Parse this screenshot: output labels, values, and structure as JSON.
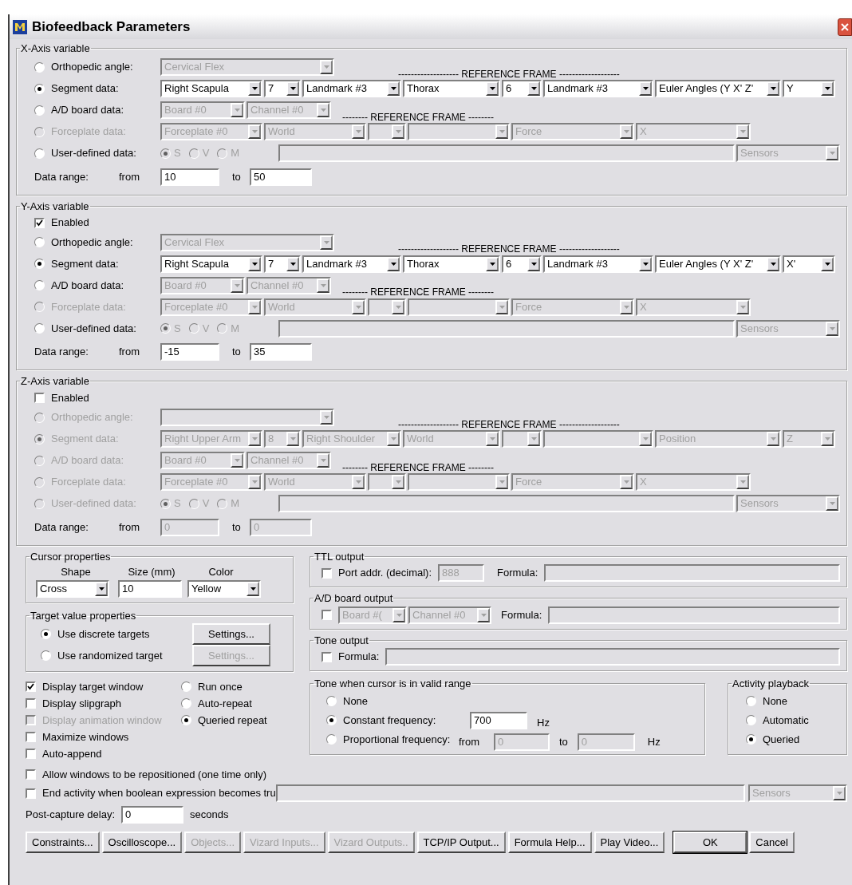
{
  "window": {
    "title": "Biofeedback Parameters"
  },
  "axes": [
    {
      "title": "X-Axis variable",
      "rows": [
        {
          "kind": "orthopedic",
          "label": "Orthopedic angle:",
          "selected": false,
          "disabled": false,
          "heading": "------------------- REFERENCE FRAME -------------------",
          "combos": [
            {
              "value": "Cervical Flex",
              "disabled": true
            }
          ]
        },
        {
          "kind": "segment",
          "label": "Segment data:",
          "selected": true,
          "disabled": false,
          "combos": [
            {
              "value": "Right Scapula",
              "disabled": false
            },
            {
              "value": "7",
              "disabled": false
            },
            {
              "value": "Landmark #3",
              "disabled": false
            },
            {
              "value": "Thorax",
              "disabled": false
            },
            {
              "value": "6",
              "disabled": false
            },
            {
              "value": "Landmark #3",
              "disabled": false
            },
            {
              "value": "Euler Angles (Y X' Z'",
              "disabled": false
            },
            {
              "value": "Y",
              "disabled": false
            }
          ]
        },
        {
          "kind": "ad",
          "label": "A/D board data:",
          "selected": false,
          "disabled": false,
          "heading": "-------- REFERENCE FRAME --------",
          "combos": [
            {
              "value": "Board #0",
              "disabled": true
            },
            {
              "value": "Channel #0",
              "disabled": true
            }
          ]
        },
        {
          "kind": "forceplate",
          "label": "Forceplate data:",
          "selected": false,
          "disabled": true,
          "combos": [
            {
              "value": "Forceplate #0",
              "disabled": true
            },
            {
              "value": "World",
              "disabled": true
            },
            {
              "disabled": true
            },
            {
              "disabled": true
            },
            {
              "value": "Force",
              "disabled": true
            },
            {
              "value": "X",
              "disabled": true
            }
          ]
        },
        {
          "kind": "user",
          "label": "User-defined data:",
          "selected": false,
          "disabled": false,
          "options": [
            {
              "label": "S",
              "selected": true
            },
            {
              "label": "V",
              "selected": false
            },
            {
              "label": "M",
              "selected": false
            }
          ],
          "combos": [
            {
              "value": "Sensors",
              "disabled": true
            }
          ]
        }
      ],
      "range": {
        "label": "Data range:",
        "from_label": "from",
        "from": "10",
        "to_label": "to",
        "to": "50",
        "disabled": false
      }
    },
    {
      "title": "Y-Axis variable",
      "enabled": {
        "label": "Enabled",
        "checked": true
      },
      "rows": [
        {
          "kind": "orthopedic",
          "label": "Orthopedic angle:",
          "selected": false,
          "disabled": false,
          "heading": "------------------- REFERENCE FRAME -------------------",
          "combos": [
            {
              "value": "Cervical Flex",
              "disabled": true
            }
          ]
        },
        {
          "kind": "segment",
          "label": "Segment data:",
          "selected": true,
          "disabled": false,
          "combos": [
            {
              "value": "Right Scapula",
              "disabled": false
            },
            {
              "value": "7",
              "disabled": false
            },
            {
              "value": "Landmark #3",
              "disabled": false
            },
            {
              "value": "Thorax",
              "disabled": false
            },
            {
              "value": "6",
              "disabled": false
            },
            {
              "value": "Landmark #3",
              "disabled": false
            },
            {
              "value": "Euler Angles (Y X' Z'",
              "disabled": false
            },
            {
              "value": "X'",
              "disabled": false
            }
          ]
        },
        {
          "kind": "ad",
          "label": "A/D board data:",
          "selected": false,
          "disabled": false,
          "heading": "-------- REFERENCE FRAME --------",
          "combos": [
            {
              "value": "Board #0",
              "disabled": true
            },
            {
              "value": "Channel #0",
              "disabled": true
            }
          ]
        },
        {
          "kind": "forceplate",
          "label": "Forceplate data:",
          "selected": false,
          "disabled": true,
          "combos": [
            {
              "value": "Forceplate #0",
              "disabled": true
            },
            {
              "value": "World",
              "disabled": true
            },
            {
              "disabled": true
            },
            {
              "disabled": true
            },
            {
              "value": "Force",
              "disabled": true
            },
            {
              "value": "X",
              "disabled": true
            }
          ]
        },
        {
          "kind": "user",
          "label": "User-defined data:",
          "selected": false,
          "disabled": false,
          "options": [
            {
              "label": "S",
              "selected": true
            },
            {
              "label": "V",
              "selected": false
            },
            {
              "label": "M",
              "selected": false
            }
          ],
          "combos": [
            {
              "value": "Sensors",
              "disabled": true
            }
          ]
        }
      ],
      "range": {
        "label": "Data range:",
        "from_label": "from",
        "from": "-15",
        "to_label": "to",
        "to": "35",
        "disabled": false
      }
    },
    {
      "title": "Z-Axis variable",
      "enabled": {
        "label": "Enabled",
        "checked": false
      },
      "rows": [
        {
          "kind": "orthopedic",
          "label": "Orthopedic angle:",
          "selected": false,
          "disabled": true,
          "heading": "------------------- REFERENCE FRAME -------------------",
          "combos": [
            {
              "disabled": true
            }
          ]
        },
        {
          "kind": "segment",
          "label": "Segment data:",
          "selected": true,
          "disabled": true,
          "combos": [
            {
              "value": "Right Upper Arm",
              "disabled": true
            },
            {
              "value": "8",
              "disabled": true
            },
            {
              "value": "Right Shoulder",
              "disabled": true
            },
            {
              "value": "World",
              "disabled": true
            },
            {
              "disabled": true
            },
            {
              "disabled": true
            },
            {
              "value": "Position",
              "disabled": true
            },
            {
              "value": "Z",
              "disabled": true
            }
          ]
        },
        {
          "kind": "ad",
          "label": "A/D board data:",
          "selected": false,
          "disabled": true,
          "heading": "-------- REFERENCE FRAME --------",
          "combos": [
            {
              "value": "Board #0",
              "disabled": true
            },
            {
              "value": "Channel #0",
              "disabled": true
            }
          ]
        },
        {
          "kind": "forceplate",
          "label": "Forceplate data:",
          "selected": false,
          "disabled": true,
          "combos": [
            {
              "value": "Forceplate #0",
              "disabled": true
            },
            {
              "value": "World",
              "disabled": true
            },
            {
              "disabled": true
            },
            {
              "disabled": true
            },
            {
              "value": "Force",
              "disabled": true
            },
            {
              "value": "X",
              "disabled": true
            }
          ]
        },
        {
          "kind": "user",
          "label": "User-defined data:",
          "selected": false,
          "disabled": true,
          "options": [
            {
              "label": "S",
              "selected": true
            },
            {
              "label": "V",
              "selected": false
            },
            {
              "label": "M",
              "selected": false
            }
          ],
          "combos": [
            {
              "value": "Sensors",
              "disabled": true
            }
          ]
        }
      ],
      "range": {
        "label": "Data range:",
        "from_label": "from",
        "from": "0",
        "to_label": "to",
        "to": "0",
        "disabled": true
      }
    }
  ],
  "cursor": {
    "title": "Cursor properties",
    "shape": {
      "label": "Shape",
      "value": "Cross"
    },
    "size": {
      "label": "Size (mm)",
      "value": "10"
    },
    "color": {
      "label": "Color",
      "value": "Yellow"
    }
  },
  "target": {
    "title": "Target value properties",
    "options": [
      {
        "label": "Use discrete targets",
        "selected": true,
        "button": {
          "label": "Settings...",
          "disabled": false
        }
      },
      {
        "label": "Use randomized target",
        "selected": false,
        "button": {
          "label": "Settings...",
          "disabled": true
        }
      }
    ]
  },
  "checks": [
    {
      "label": "Display target window",
      "checked": true,
      "disabled": false
    },
    {
      "label": "Display slipgraph",
      "checked": false,
      "disabled": false
    },
    {
      "label": "Display animation window",
      "checked": false,
      "disabled": true
    },
    {
      "label": "Maximize windows",
      "checked": false,
      "disabled": false
    },
    {
      "label": "Auto-append",
      "checked": false,
      "disabled": false
    }
  ],
  "repeat": [
    {
      "label": "Run once",
      "selected": false
    },
    {
      "label": "Auto-repeat",
      "selected": false
    },
    {
      "label": "Queried repeat",
      "selected": true
    }
  ],
  "ttl": {
    "title": "TTL output",
    "checked": false,
    "port_label": "Port addr. (decimal):",
    "port": "888",
    "formula_label": "Formula:"
  },
  "ad_output": {
    "title": "A/D board output",
    "checked": false,
    "board": "Board #(",
    "channel": "Channel #0",
    "formula_label": "Formula:"
  },
  "tone_output": {
    "title": "Tone output",
    "checked": false,
    "formula_label": "Formula:"
  },
  "tone_range": {
    "title": "Tone when cursor is in valid range",
    "options": [
      {
        "label": "None",
        "selected": false
      },
      {
        "label": "Constant frequency:",
        "selected": true
      },
      {
        "label": "Proportional frequency:",
        "selected": false
      }
    ],
    "frequency": "700",
    "hz": "Hz",
    "from_label": "from",
    "from": "0",
    "to_label": "to",
    "to": "0",
    "hz2": "Hz"
  },
  "playback": {
    "title": "Activity playback",
    "options": [
      {
        "label": "None",
        "selected": false
      },
      {
        "label": "Automatic",
        "selected": false
      },
      {
        "label": "Queried",
        "selected": true
      }
    ]
  },
  "allow": {
    "label": "Allow windows to be repositioned (one time only)",
    "checked": false
  },
  "end_activity": {
    "label": "End activity when boolean expression becomes tru",
    "checked": false,
    "sensors": "Sensors"
  },
  "post_capture": {
    "label": "Post-capture delay:",
    "value": "0",
    "unit": "seconds"
  },
  "buttons": [
    {
      "label": "Constraints...",
      "disabled": false,
      "default": false
    },
    {
      "label": "Oscilloscope...",
      "disabled": false,
      "default": false
    },
    {
      "label": "Objects...",
      "disabled": true,
      "default": false
    },
    {
      "label": "Vizard Inputs...",
      "disabled": true,
      "default": false
    },
    {
      "label": "Vizard Outputs..",
      "disabled": true,
      "default": false
    },
    {
      "label": "TCP/IP Output...",
      "disabled": false,
      "default": false
    },
    {
      "label": "Formula Help...",
      "disabled": false,
      "default": false
    },
    {
      "label": "Play Video...",
      "disabled": false,
      "default": false
    },
    {
      "label": "OK",
      "disabled": false,
      "default": true
    },
    {
      "label": "Cancel",
      "disabled": false,
      "default": false
    }
  ]
}
